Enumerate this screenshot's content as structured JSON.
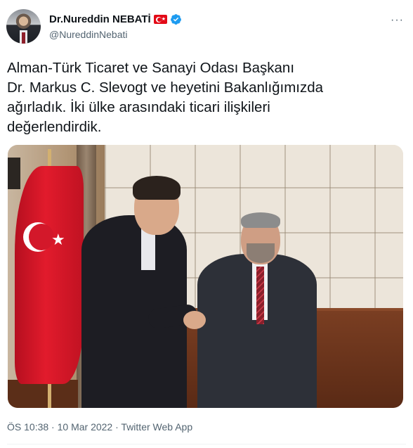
{
  "author": {
    "display_name": "Dr.Nureddin NEBATİ",
    "handle": "@NureddinNebati",
    "flag_icon": "turkey-flag-icon",
    "verified_icon": "verified-badge-icon",
    "verified_color": "#1d9bf0"
  },
  "menu": {
    "more_label": "···"
  },
  "tweet": {
    "lines": [
      "Alman-Türk Ticaret ve Sanayi Odası Başkanı",
      "Dr. Markus C. Slevogt ve heyetini Bakanlığımızda",
      "ağırladık. İki ülke arasındaki ticari ilişkileri",
      "değerlendirdik."
    ]
  },
  "meta": {
    "time": "ÖS 10:38",
    "separator": " · ",
    "date": "10 Mar 2022",
    "app": "Twitter Web App"
  },
  "colors": {
    "text": "#0f1419",
    "secondary": "#536471",
    "divider": "#eff3f4"
  }
}
